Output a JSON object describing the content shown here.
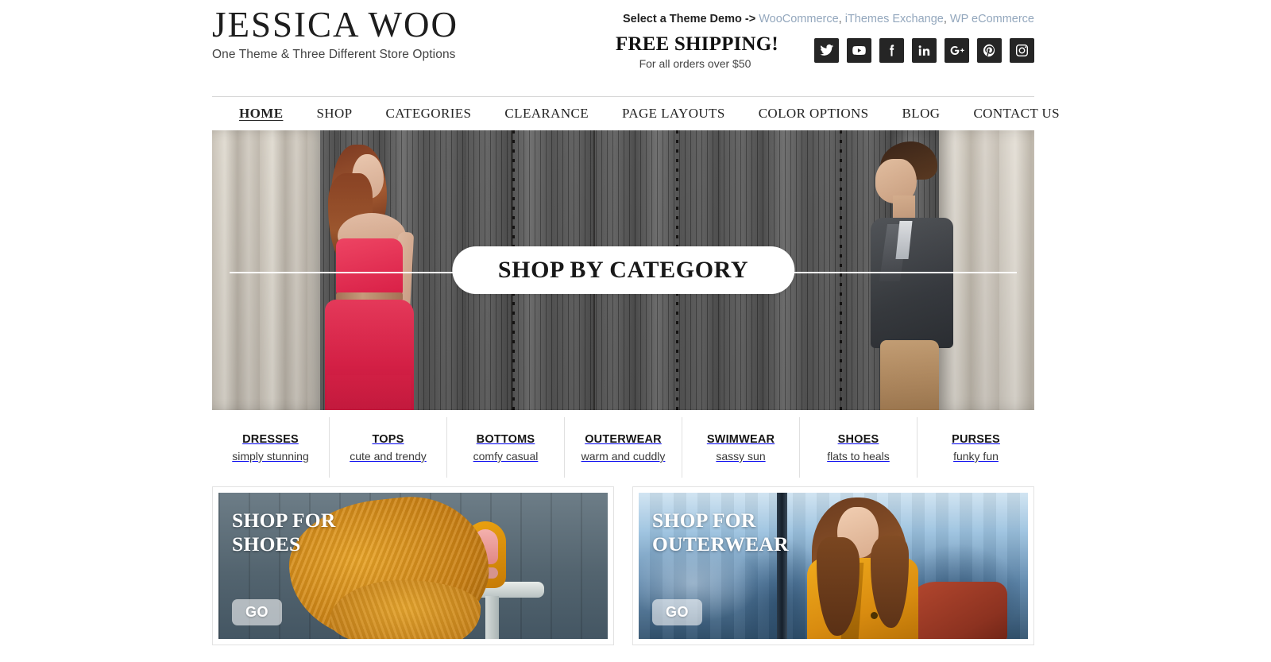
{
  "brand": {
    "title": "JESSICA WOO",
    "tagline": "One Theme & Three Different Store Options"
  },
  "header": {
    "demo_label": "Select a Theme Demo ->",
    "demo_links": [
      "WooCommerce",
      "iThemes Exchange",
      "WP eCommerce"
    ],
    "demo_separator": ", ",
    "shipping_title": "FREE SHIPPING!",
    "shipping_sub": "For all orders over $50",
    "link_color": "#93a7bd",
    "social": [
      {
        "name": "twitter",
        "label": "Twitter"
      },
      {
        "name": "youtube",
        "label": "YouTube"
      },
      {
        "name": "facebook",
        "label": "Facebook"
      },
      {
        "name": "linkedin",
        "label": "LinkedIn"
      },
      {
        "name": "googleplus",
        "label": "Google Plus"
      },
      {
        "name": "pinterest",
        "label": "Pinterest"
      },
      {
        "name": "instagram",
        "label": "Instagram"
      }
    ]
  },
  "nav": {
    "items": [
      {
        "label": "HOME",
        "active": true
      },
      {
        "label": "SHOP",
        "active": false
      },
      {
        "label": "CATEGORIES",
        "active": false
      },
      {
        "label": "CLEARANCE",
        "active": false
      },
      {
        "label": "PAGE LAYOUTS",
        "active": false
      },
      {
        "label": "COLOR OPTIONS",
        "active": false
      },
      {
        "label": "BLOG",
        "active": false
      },
      {
        "label": "CONTACT US",
        "active": false
      }
    ]
  },
  "hero": {
    "badge_label": "SHOP BY CATEGORY"
  },
  "categories": [
    {
      "name": "DRESSES",
      "sub": "simply stunning"
    },
    {
      "name": "TOPS",
      "sub": "cute and trendy"
    },
    {
      "name": "BOTTOMS",
      "sub": "comfy casual"
    },
    {
      "name": "OUTERWEAR",
      "sub": "warm and cuddly"
    },
    {
      "name": "SWIMWEAR",
      "sub": "sassy sun"
    },
    {
      "name": "SHOES",
      "sub": "flats to heals"
    },
    {
      "name": "PURSES",
      "sub": "funky fun"
    }
  ],
  "promos": [
    {
      "title": "SHOP FOR\nSHOES",
      "title_line1": "SHOP FOR",
      "title_line2": "SHOES",
      "go_label": "GO"
    },
    {
      "title": "SHOP FOR\nOUTERWEAR",
      "title_line1": "SHOP FOR",
      "title_line2": "OUTERWEAR",
      "go_label": "GO"
    }
  ]
}
